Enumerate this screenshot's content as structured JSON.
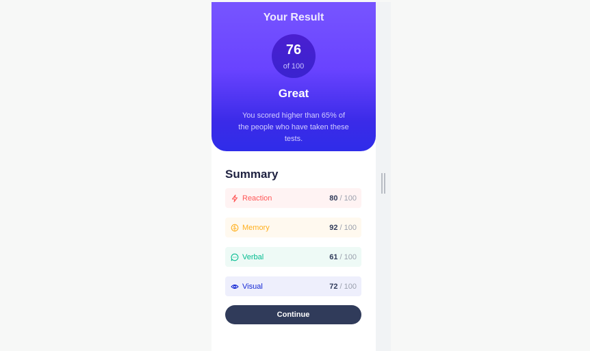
{
  "result": {
    "title": "Your Result",
    "score": "76",
    "score_of": "of 100",
    "rating": "Great",
    "description": "You scored higher than 65% of the people who have taken these tests."
  },
  "summary": {
    "title": "Summary",
    "items": [
      {
        "label": "Reaction",
        "score": "80",
        "max": "/ 100",
        "icon": "lightning-icon",
        "color": "#ff5757"
      },
      {
        "label": "Memory",
        "score": "92",
        "max": "/ 100",
        "icon": "brain-icon",
        "color": "#ffb01f"
      },
      {
        "label": "Verbal",
        "score": "61",
        "max": "/ 100",
        "icon": "chat-bubble-icon",
        "color": "#00bb8f"
      },
      {
        "label": "Visual",
        "score": "72",
        "max": "/ 100",
        "icon": "eye-icon",
        "color": "#1125d4"
      }
    ]
  },
  "continue_label": "Continue",
  "colors": {
    "gradient_top": "#7755ff",
    "gradient_bottom": "#2f2ce9",
    "button": "#303b5a"
  }
}
